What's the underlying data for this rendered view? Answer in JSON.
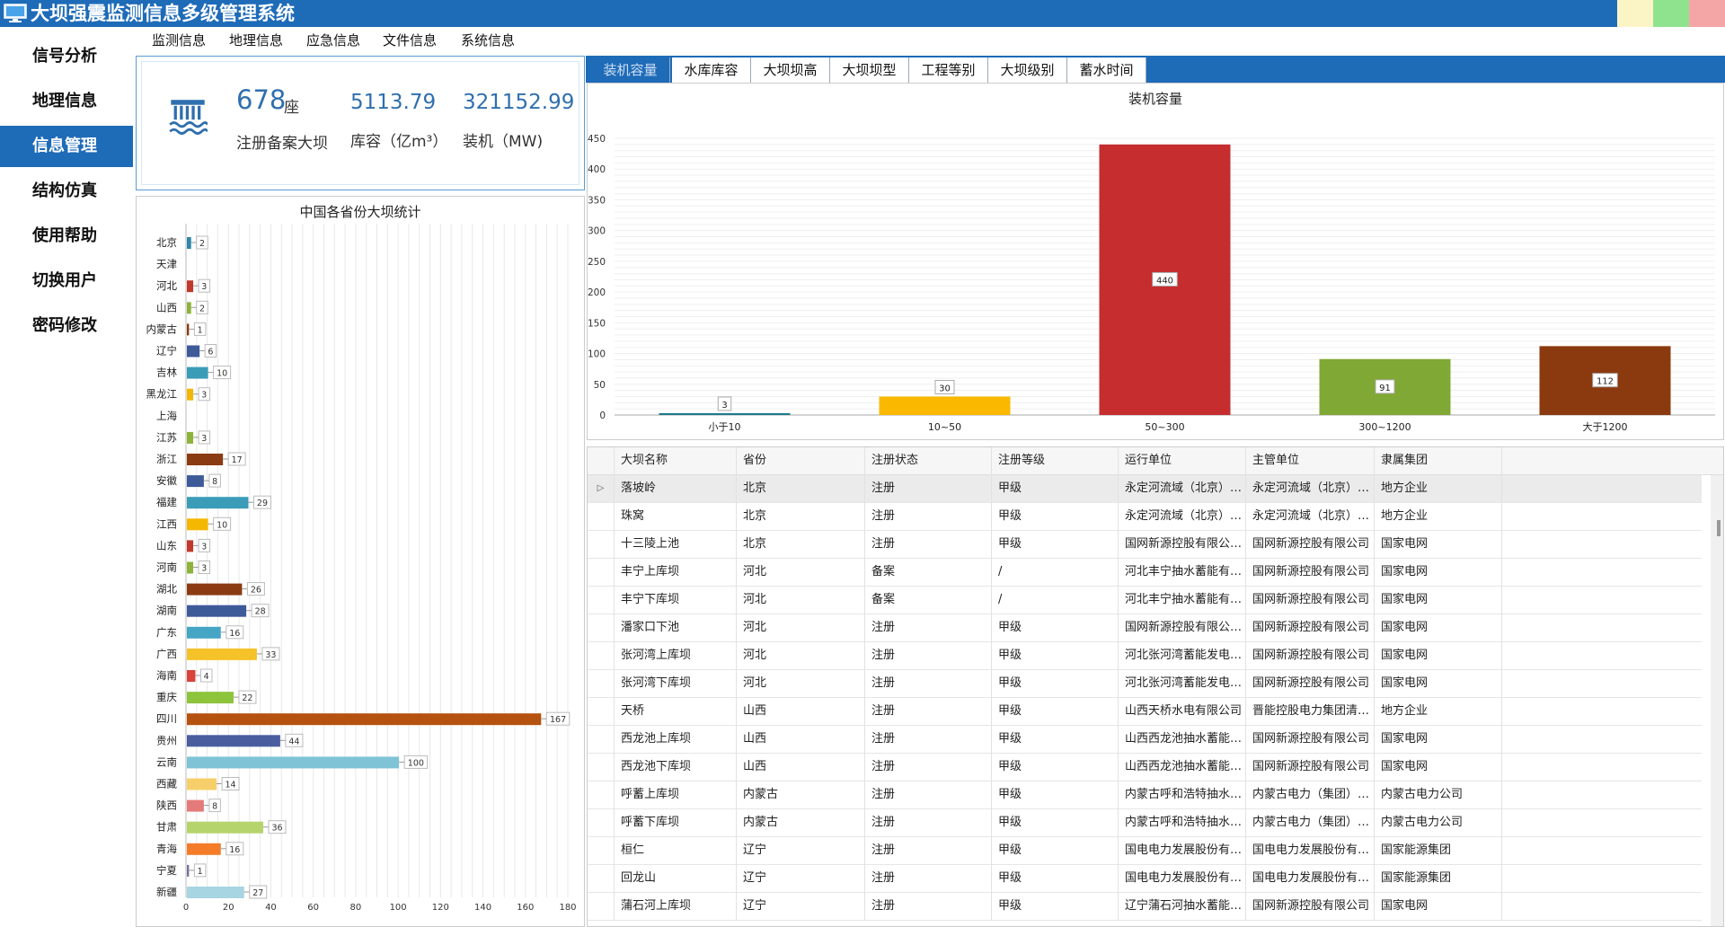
{
  "window": {
    "title": "大坝强震监测信息多级管理系统"
  },
  "sidebar": {
    "items": [
      {
        "label": "信号分析",
        "active": false
      },
      {
        "label": "地理信息",
        "active": false
      },
      {
        "label": "信息管理",
        "active": true
      },
      {
        "label": "结构仿真",
        "active": false
      },
      {
        "label": "使用帮助",
        "active": false
      },
      {
        "label": "切换用户",
        "active": false
      },
      {
        "label": "密码修改",
        "active": false
      }
    ]
  },
  "menu": {
    "items": [
      "监测信息",
      "地理信息",
      "应急信息",
      "文件信息",
      "系统信息"
    ]
  },
  "summary": {
    "dam_count": "678",
    "dam_unit": "座",
    "dam_label": "注册备案大坝",
    "storage_value": "5113.79",
    "storage_label": "库容（亿m³）",
    "capacity_value": "321152.99",
    "capacity_label": "装机（MW)"
  },
  "province_chart": {
    "title": "中国各省份大坝统计"
  },
  "tabs": [
    "装机容量",
    "水库库容",
    "大坝坝高",
    "大坝坝型",
    "工程等别",
    "大坝级别",
    "蓄水时间"
  ],
  "selected_tab": 0,
  "capacity_chart": {
    "title": "装机容量"
  },
  "chart_data": [
    {
      "type": "bar",
      "orientation": "horizontal",
      "title": "中国各省份大坝统计",
      "categories": [
        "北京",
        "天津",
        "河北",
        "山西",
        "内蒙古",
        "辽宁",
        "吉林",
        "黑龙江",
        "上海",
        "江苏",
        "浙江",
        "安徽",
        "福建",
        "江西",
        "山东",
        "河南",
        "湖北",
        "湖南",
        "广东",
        "广西",
        "海南",
        "重庆",
        "四川",
        "贵州",
        "云南",
        "西藏",
        "陕西",
        "甘肃",
        "青海",
        "宁夏",
        "新疆"
      ],
      "values": [
        2,
        null,
        3,
        2,
        1,
        6,
        10,
        3,
        null,
        3,
        17,
        8,
        29,
        10,
        3,
        3,
        26,
        28,
        16,
        33,
        4,
        22,
        167,
        44,
        100,
        14,
        8,
        36,
        16,
        1,
        27
      ],
      "colors": [
        "#2e86ab",
        "#2e86ab",
        "#c0392b",
        "#8db33a",
        "#8a3b12",
        "#3d5a99",
        "#3b9cb8",
        "#f2b705",
        "#8db33a",
        "#8db33a",
        "#8a3b12",
        "#3d5a99",
        "#3b9cb8",
        "#f5b800",
        "#c0392b",
        "#8db33a",
        "#8a3b12",
        "#3d5a99",
        "#45a5c4",
        "#f5c22a",
        "#d9433a",
        "#8dc43c",
        "#b5520f",
        "#4a5d9e",
        "#7ec3d6",
        "#f7cf6a",
        "#e57a7a",
        "#b5d46c",
        "#f47c28",
        "#7a6f9a",
        "#a8d5e2"
      ],
      "xlim": [
        0,
        180
      ],
      "xticks": [
        0,
        20,
        40,
        60,
        80,
        100,
        120,
        140,
        160,
        180
      ],
      "grid": true
    },
    {
      "type": "bar",
      "title": "装机容量",
      "categories": [
        "小于10",
        "10~50",
        "50~300",
        "300~1200",
        "大于1200"
      ],
      "values": [
        3,
        30,
        440,
        91,
        112
      ],
      "colors": [
        "#1f7a8c",
        "#fbb800",
        "#c62d2f",
        "#80a834",
        "#8b3a0f"
      ],
      "ylim": [
        0,
        450
      ],
      "yticks": [
        0,
        50,
        100,
        150,
        200,
        250,
        300,
        350,
        400,
        450
      ],
      "grid": true
    }
  ],
  "table": {
    "columns": [
      "大坝名称",
      "省份",
      "注册状态",
      "注册等级",
      "运行单位",
      "主管单位",
      "隶属集团"
    ],
    "rows": [
      [
        "落坡岭",
        "北京",
        "注册",
        "甲级",
        "永定河流域（北京）企业...",
        "永定河流域（北京）企业...",
        "地方企业"
      ],
      [
        "珠窝",
        "北京",
        "注册",
        "甲级",
        "永定河流域（北京）企业...",
        "永定河流域（北京）企业...",
        "地方企业"
      ],
      [
        "十三陵上池",
        "北京",
        "注册",
        "甲级",
        "国网新源控股有限公司北...",
        "国网新源控股有限公司",
        "国家电网"
      ],
      [
        "丰宁上库坝",
        "河北",
        "备案",
        "/",
        "河北丰宁抽水蓄能有限公司",
        "国网新源控股有限公司",
        "国家电网"
      ],
      [
        "丰宁下库坝",
        "河北",
        "备案",
        "/",
        "河北丰宁抽水蓄能有限公司",
        "国网新源控股有限公司",
        "国家电网"
      ],
      [
        "潘家口下池",
        "河北",
        "注册",
        "甲级",
        "国网新源控股有限公司潘...",
        "国网新源控股有限公司",
        "国家电网"
      ],
      [
        "张河湾上库坝",
        "河北",
        "注册",
        "甲级",
        "河北张河湾蓄能发电有限...",
        "国网新源控股有限公司",
        "国家电网"
      ],
      [
        "张河湾下库坝",
        "河北",
        "注册",
        "甲级",
        "河北张河湾蓄能发电有限...",
        "国网新源控股有限公司",
        "国家电网"
      ],
      [
        "天桥",
        "山西",
        "注册",
        "甲级",
        "山西天桥水电有限公司",
        "晋能控股电力集团清洁能...",
        "地方企业"
      ],
      [
        "西龙池上库坝",
        "山西",
        "注册",
        "甲级",
        "山西西龙池抽水蓄能电站...",
        "国网新源控股有限公司",
        "国家电网"
      ],
      [
        "西龙池下库坝",
        "山西",
        "注册",
        "甲级",
        "山西西龙池抽水蓄能电站...",
        "国网新源控股有限公司",
        "国家电网"
      ],
      [
        "呼蓄上库坝",
        "内蒙古",
        "注册",
        "甲级",
        "内蒙古呼和浩特抽水蓄能...",
        "内蒙古电力（集团）有限...",
        "内蒙古电力公司"
      ],
      [
        "呼蓄下库坝",
        "内蒙古",
        "注册",
        "甲级",
        "内蒙古呼和浩特抽水蓄能...",
        "内蒙古电力（集团）有限...",
        "内蒙古电力公司"
      ],
      [
        "桓仁",
        "辽宁",
        "注册",
        "甲级",
        "国电电力发展股份有限公...",
        "国电电力发展股份有限公司",
        "国家能源集团"
      ],
      [
        "回龙山",
        "辽宁",
        "注册",
        "甲级",
        "国电电力发展股份有限公...",
        "国电电力发展股份有限公司",
        "国家能源集团"
      ],
      [
        "蒲石河上库坝",
        "辽宁",
        "注册",
        "甲级",
        "辽宁蒲石河抽水蓄能有限...",
        "国网新源控股有限公司",
        "国家电网"
      ]
    ],
    "selected_row": 0,
    "row_indicator": "▷"
  }
}
